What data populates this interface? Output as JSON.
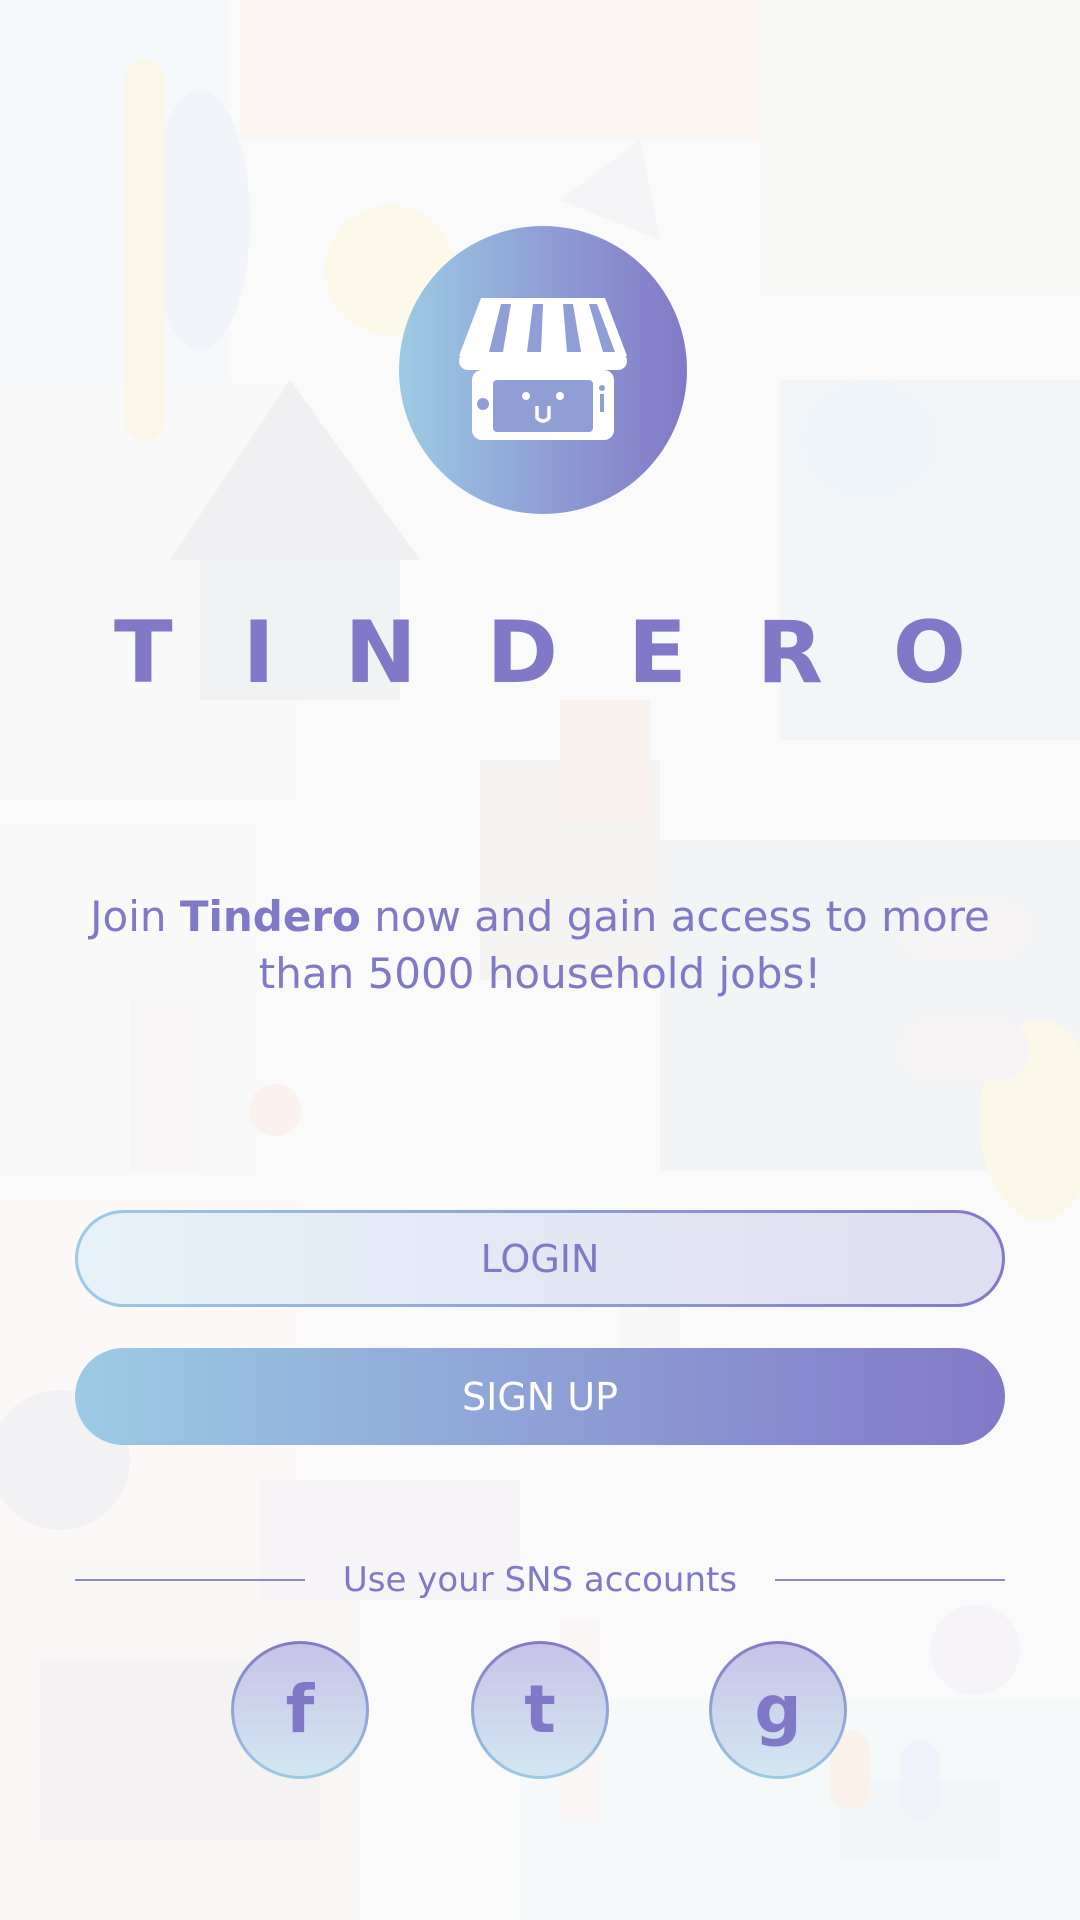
{
  "brand": {
    "name": "TINDERO",
    "logo_icon": "storefront-icon"
  },
  "tagline": {
    "before": "Join ",
    "bold": "Tindero",
    "after": " now and gain access to more than 5000 household jobs!"
  },
  "actions": {
    "login_label": "LOGIN",
    "signup_label": "SIGN UP"
  },
  "sns": {
    "divider_label": "Use your SNS accounts",
    "buttons": [
      {
        "letter": "f",
        "icon": "facebook-icon"
      },
      {
        "letter": "t",
        "icon": "twitter-icon"
      },
      {
        "letter": "g",
        "icon": "google-icon"
      }
    ]
  },
  "colors": {
    "accent_purple": "#8179c8",
    "accent_blue": "#9ccbe4",
    "white": "#ffffff"
  }
}
